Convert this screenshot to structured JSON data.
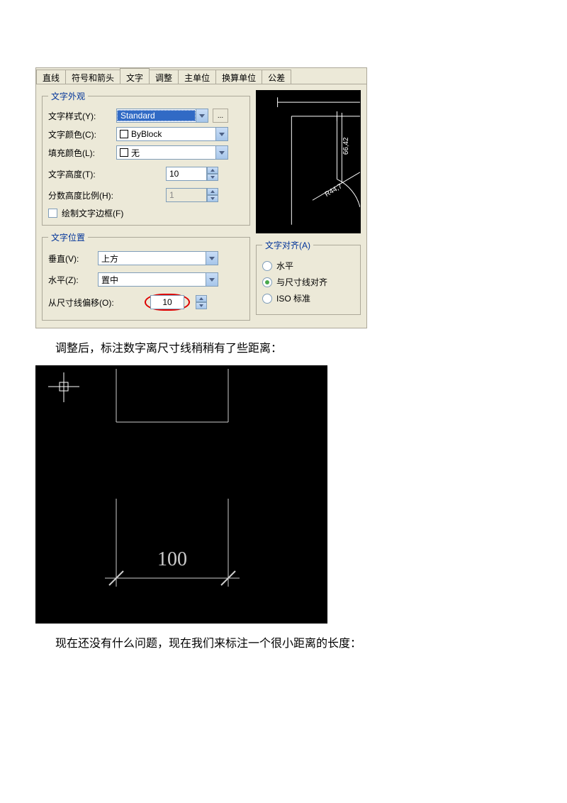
{
  "dialog": {
    "tabs": [
      "直线",
      "符号和箭头",
      "文字",
      "调整",
      "主单位",
      "换算单位",
      "公差"
    ],
    "active_tab_index": 2,
    "group_appearance": {
      "legend": "文字外观",
      "style_label": "文字样式(Y):",
      "style_value": "Standard",
      "style_dots": "...",
      "color_label": "文字颜色(C):",
      "color_value": "ByBlock",
      "fill_label": "填充颜色(L):",
      "fill_value": "无",
      "height_label": "文字高度(T):",
      "height_value": "10",
      "fraction_label": "分数高度比例(H):",
      "fraction_value": "1",
      "frame_checkbox_label": "绘制文字边框(F)"
    },
    "group_position": {
      "legend": "文字位置",
      "vertical_label": "垂直(V):",
      "vertical_value": "上方",
      "horizontal_label": "水平(Z):",
      "horizontal_value": "置中",
      "offset_label": "从尺寸线偏移(O):",
      "offset_value": "10"
    },
    "group_align": {
      "legend": "文字对齐(A)",
      "opt_horizontal": "水平",
      "opt_withline": "与尺寸线对齐",
      "opt_iso": "ISO 标准"
    },
    "preview": {
      "dim1": "66,42",
      "dim2": "R44,7"
    }
  },
  "text1": "调整后，标注数字离尺寸线稍稍有了些距离：",
  "cad": {
    "dim_value": "100"
  },
  "text2": "现在还没有什么问题，现在我们来标注一个很小距离的长度："
}
